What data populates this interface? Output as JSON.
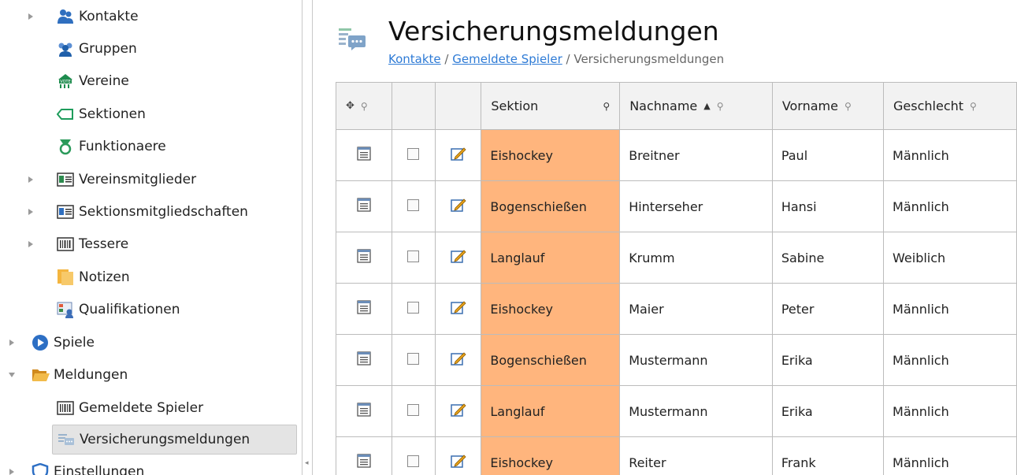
{
  "sidebar": {
    "items": [
      {
        "label": "Kontakte",
        "icon": "contacts-icon",
        "expandable": true
      },
      {
        "label": "Gruppen",
        "icon": "groups-icon",
        "expandable": false
      },
      {
        "label": "Vereine",
        "icon": "clubs-icon",
        "expandable": false
      },
      {
        "label": "Sektionen",
        "icon": "sections-icon",
        "expandable": false
      },
      {
        "label": "Funktionaere",
        "icon": "medal-icon",
        "expandable": false
      },
      {
        "label": "Vereinsmitglieder",
        "icon": "id-card-icon",
        "expandable": true
      },
      {
        "label": "Sektionsmitgliedschaften",
        "icon": "id-card-icon",
        "expandable": true
      },
      {
        "label": "Tessere",
        "icon": "barcode-icon",
        "expandable": true
      },
      {
        "label": "Notizen",
        "icon": "notes-icon",
        "expandable": false
      },
      {
        "label": "Qualifikationen",
        "icon": "qualifications-icon",
        "expandable": false
      },
      {
        "label": "Spiele",
        "icon": "play-icon",
        "expandable": true
      },
      {
        "label": "Meldungen",
        "icon": "folder-open-icon",
        "expandable": true,
        "expanded": true
      },
      {
        "label": "Gemeldete Spieler",
        "icon": "barcode-icon",
        "expandable": false
      },
      {
        "label": "Versicherungsmeldungen",
        "icon": "insurance-report-icon",
        "expandable": false,
        "selected": true
      },
      {
        "label": "Einstellungen",
        "icon": "settings-shield-icon",
        "expandable": true
      }
    ]
  },
  "page": {
    "title": "Versicherungsmeldungen",
    "breadcrumb": {
      "link1": "Kontakte",
      "sep1": " / ",
      "link2": "Gemeldete Spieler",
      "sep2": " / ",
      "current": "Versicherungsmeldungen"
    }
  },
  "grid": {
    "columns": {
      "move": "✥",
      "sektion": "Sektion",
      "nachname": "Nachname",
      "nachname_sort": "▲",
      "vorname": "Vorname",
      "geschlecht": "Geschlecht"
    },
    "rows": [
      {
        "sektion": "Eishockey",
        "nachname": "Breitner",
        "vorname": "Paul",
        "geschlecht": "Männlich"
      },
      {
        "sektion": "Bogenschießen",
        "nachname": "Hinterseher",
        "vorname": "Hansi",
        "geschlecht": "Männlich"
      },
      {
        "sektion": "Langlauf",
        "nachname": "Krumm",
        "vorname": "Sabine",
        "geschlecht": "Weiblich"
      },
      {
        "sektion": "Eishockey",
        "nachname": "Maier",
        "vorname": "Peter",
        "geschlecht": "Männlich"
      },
      {
        "sektion": "Bogenschießen",
        "nachname": "Mustermann",
        "vorname": "Erika",
        "geschlecht": "Männlich"
      },
      {
        "sektion": "Langlauf",
        "nachname": "Mustermann",
        "vorname": "Erika",
        "geschlecht": "Männlich"
      },
      {
        "sektion": "Eishockey",
        "nachname": "Reiter",
        "vorname": "Frank",
        "geschlecht": "Männlich"
      }
    ]
  },
  "colors": {
    "sektion_cell": "#ffb57d",
    "link": "#2e7bd6",
    "header_bg": "#f2f2f2",
    "selected_bg": "#e4e4e4"
  }
}
